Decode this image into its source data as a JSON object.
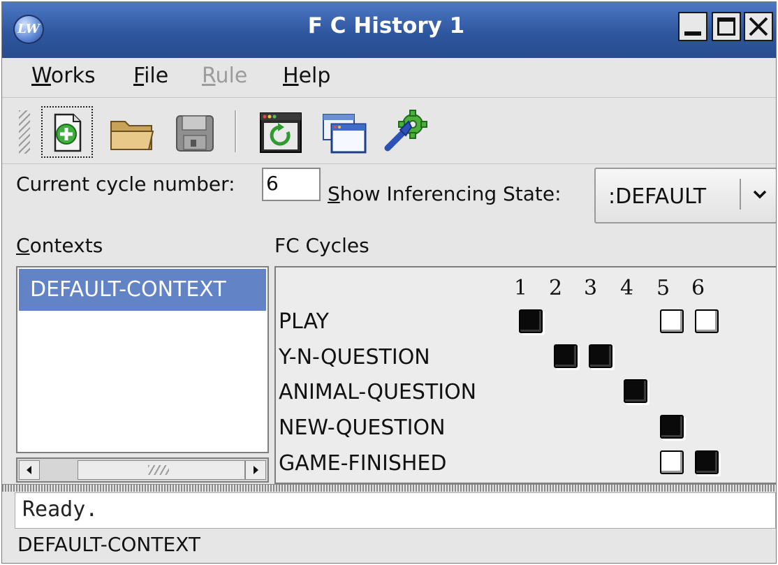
{
  "window": {
    "title": "F C History 1",
    "app_icon_text": "LW"
  },
  "menu": [
    {
      "mnemonic": "W",
      "rest": "orks",
      "enabled": true
    },
    {
      "mnemonic": "F",
      "rest": "ile",
      "enabled": true
    },
    {
      "mnemonic": "R",
      "rest": "ule",
      "enabled": false
    },
    {
      "mnemonic": "H",
      "rest": "elp",
      "enabled": true
    }
  ],
  "toolbar": {
    "icons": [
      "new-icon",
      "open-folder-icon",
      "save-disk-icon",
      "refresh-window-icon",
      "windows-icon",
      "tools-gear-icon"
    ]
  },
  "cycle": {
    "label": "Current cycle number:",
    "value": "6"
  },
  "inferencing": {
    "label_mnemonic": "S",
    "label_rest": "how Inferencing State:",
    "value": ":DEFAULT"
  },
  "contexts": {
    "label_mnemonic": "C",
    "label_rest": "ontexts",
    "items": [
      "DEFAULT-CONTEXT"
    ],
    "selected": 0
  },
  "fc_cycles": {
    "label": "FC Cycles",
    "cycle_numbers": [
      "1",
      "2",
      "3",
      "4",
      "5",
      "6"
    ],
    "rows": [
      {
        "name": "PLAY",
        "cells": [
          "filled",
          "",
          "",
          "",
          "empty",
          "empty"
        ]
      },
      {
        "name": "Y-N-QUESTION",
        "cells": [
          "",
          "filled",
          "filled",
          "",
          "",
          ""
        ]
      },
      {
        "name": "ANIMAL-QUESTION",
        "cells": [
          "",
          "",
          "",
          "filled",
          "",
          ""
        ]
      },
      {
        "name": "NEW-QUESTION",
        "cells": [
          "",
          "",
          "",
          "",
          "filled",
          ""
        ]
      },
      {
        "name": "GAME-FINISHED",
        "cells": [
          "",
          "",
          "",
          "",
          "empty",
          "filled"
        ]
      }
    ]
  },
  "status": {
    "message": "Ready.",
    "context": "DEFAULT-CONTEXT"
  },
  "colors": {
    "titlebar": "#2f579f",
    "selection": "#6283c5",
    "window_bg": "#e6e6e6"
  }
}
